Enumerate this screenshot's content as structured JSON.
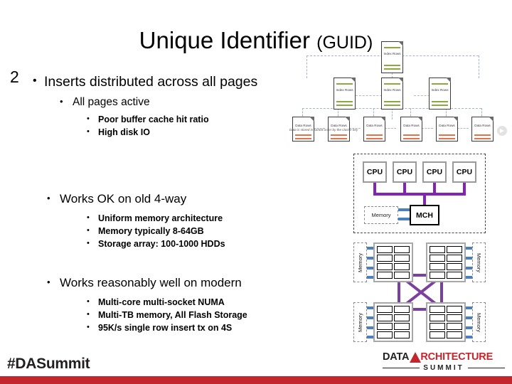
{
  "slide": {
    "number": "2",
    "title_main": "Unique Identifier ",
    "title_sub": "(GUID)"
  },
  "bullets": [
    {
      "level1": "Inserts distributed across all pages",
      "level2": [
        {
          "text": "All pages active",
          "level3": [
            "Poor buffer cache hit ratio",
            "High disk IO"
          ]
        }
      ]
    },
    {
      "level1": "Works OK on old 4-way",
      "level2": [
        {
          "text": "",
          "level3": [
            "Uniform memory architecture",
            "Memory typically 8-64GB",
            "Storage array: 100-1000 HDDs"
          ]
        }
      ]
    },
    {
      "level1": "Works reasonably well on modern",
      "level2": [
        {
          "text": "",
          "level3": [
            "Multi-core multi-socket NUMA",
            "Multi-TB memory, All Flash Storage",
            "95K/s single row insert tx on 4S"
          ]
        }
      ]
    }
  ],
  "btree": {
    "root_label": "Index\nRows",
    "root": "Index Rows",
    "mid": [
      "Index Rows",
      "Index Rows",
      "Index Rows"
    ],
    "leaves": [
      "Data Rows",
      "Data Rows",
      "Data Rows",
      "Data Rows",
      "Data Rows",
      "Data Rows"
    ],
    "caption": "Data is stored in sorted order by the cluster key",
    "index_rule_color": "#8aa83c",
    "data_rule_color": "#e3714a"
  },
  "smp": {
    "cpus": [
      "CPU",
      "CPU",
      "CPU",
      "CPU"
    ],
    "mch": "MCH",
    "memory": "Memory",
    "bus_color": "#8223b8",
    "memlink_color": "#4a7fbf"
  },
  "numa": {
    "memories": [
      "Memory",
      "Memory",
      "Memory",
      "Memory"
    ],
    "cores_per_socket": 8,
    "sockets": 4,
    "interconnect_color": "#7b3fa0",
    "memlink_color": "#4a7fbf"
  },
  "footer": {
    "hashtag": "#DASummit",
    "logo_data": "DATA",
    "logo_arch": "RCHITECTURE",
    "logo_summit": "SUMMIT",
    "bar_color": "#c4262e"
  }
}
